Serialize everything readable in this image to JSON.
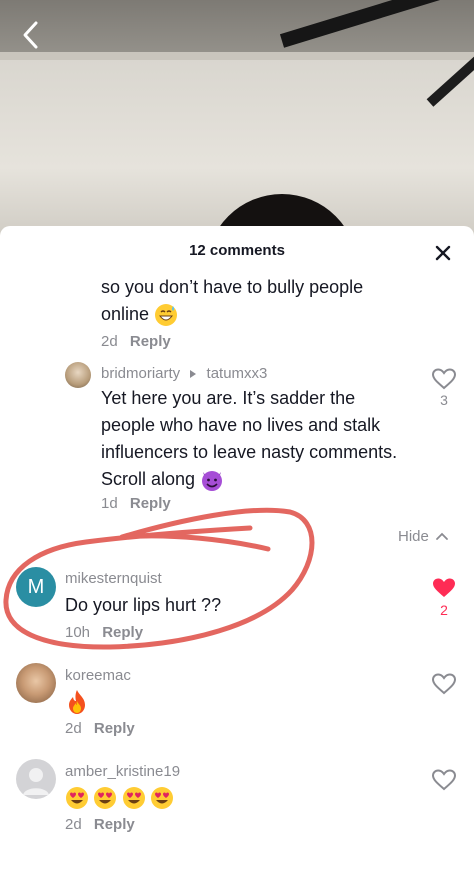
{
  "video": {
    "back_icon": "chevron-left-icon"
  },
  "sheet": {
    "title": "12 comments",
    "close_icon": "close-icon"
  },
  "comments": [
    {
      "text_line1": "so you don’t have to bully people",
      "text_line2": "online",
      "emoji": "grinning-sweat",
      "time": "2d",
      "reply": "Reply"
    },
    {
      "username": "bridmoriarty",
      "reply_to": "tatumxx3",
      "text_line1": "Yet here you are. It’s sadder the",
      "text_line2": "people who have no lives and stalk",
      "text_line3": "influencers to leave nasty comments.",
      "text_line4": "Scroll along",
      "emoji": "smiling-imp",
      "time": "1d",
      "reply": "Reply",
      "likes": "3"
    },
    {
      "username": "mikesternquist",
      "avatar_letter": "M",
      "text": "Do your lips hurt ??",
      "time": "10h",
      "reply": "Reply",
      "likes": "2",
      "liked": true
    },
    {
      "username": "koreemac",
      "emoji": "fire",
      "time": "2d",
      "reply": "Reply"
    },
    {
      "username": "amber_kristine19",
      "emoji": "heart-eyes x4",
      "time": "2d",
      "reply": "Reply"
    }
  ],
  "hide_label": "Hide",
  "colors": {
    "accent_red": "#fe2c55",
    "avatar_teal": "#2a8ea3",
    "annotation_red": "#e0574f"
  }
}
